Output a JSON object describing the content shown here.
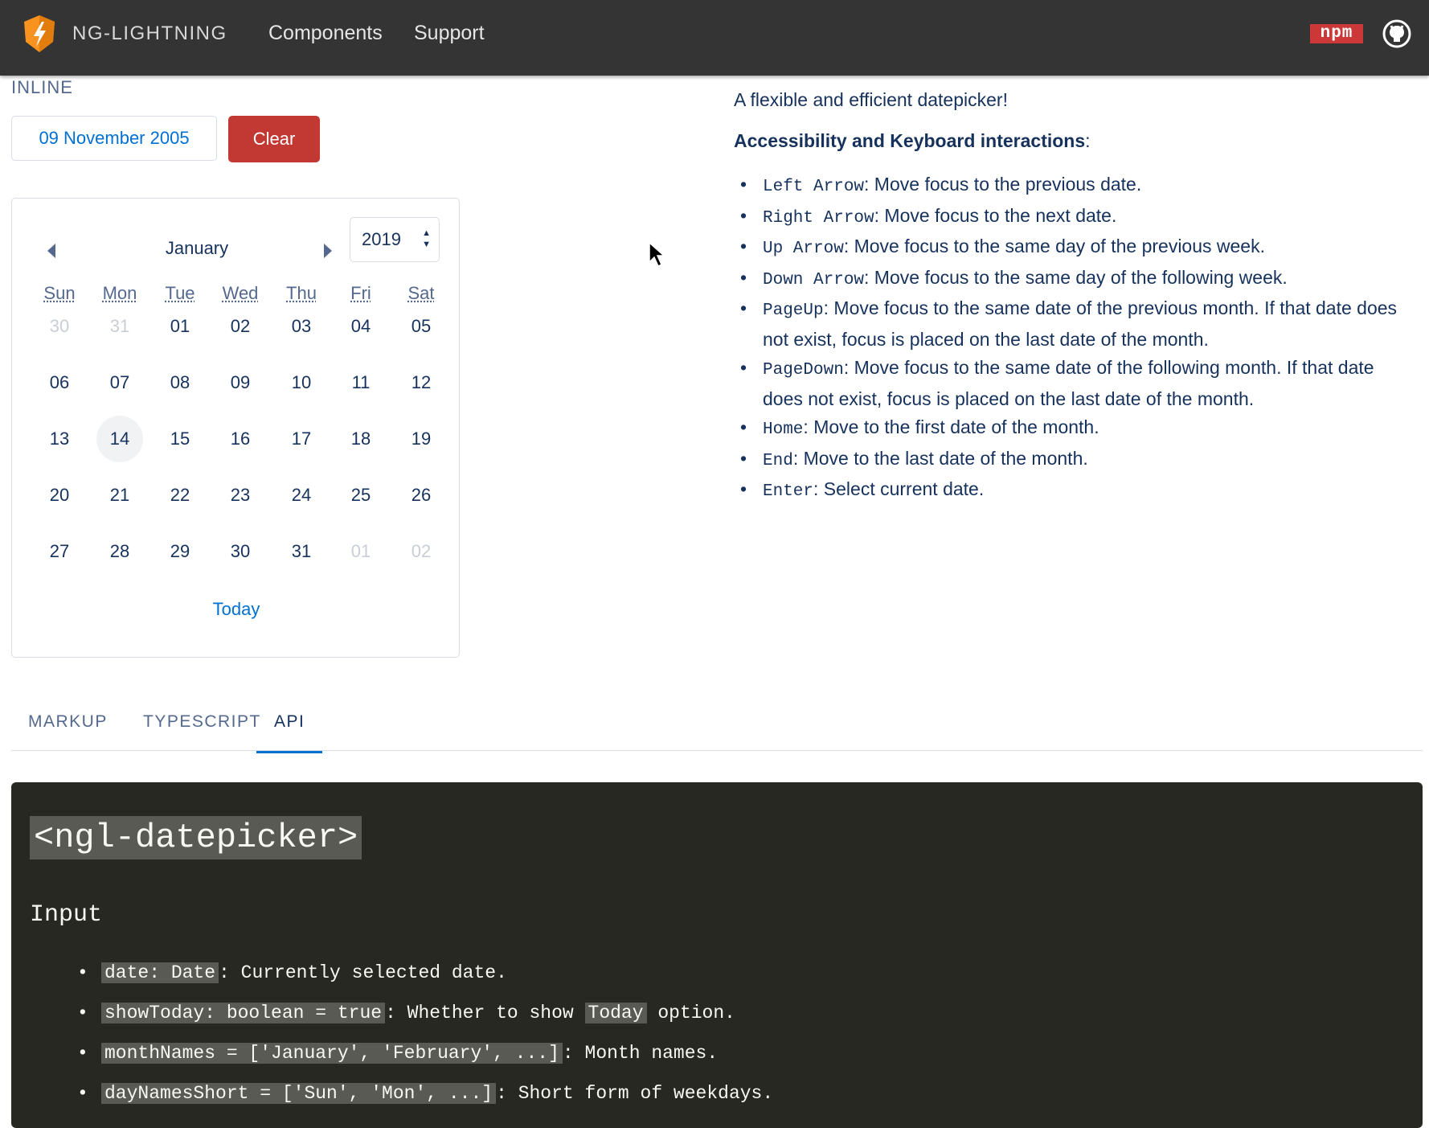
{
  "colors": {
    "topbar": "#343434",
    "accent": "#0070d2",
    "danger": "#c23934",
    "text": "#16325c",
    "code_bg": "#272822"
  },
  "header": {
    "brand": "NG-LIGHTNING",
    "nav": [
      "Components",
      "Support"
    ],
    "npm_label": "npm",
    "icons": [
      "lightning-logo-icon",
      "npm-icon",
      "github-icon"
    ]
  },
  "demo": {
    "section_label": "INLINE",
    "input_value": "09 November 2005",
    "clear_label": "Clear",
    "calendar": {
      "month": "January",
      "year": "2019",
      "day_headers": [
        "Sun",
        "Mon",
        "Tue",
        "Wed",
        "Thu",
        "Fri",
        "Sat"
      ],
      "weeks": [
        [
          "30",
          "31",
          "01",
          "02",
          "03",
          "04",
          "05"
        ],
        [
          "06",
          "07",
          "08",
          "09",
          "10",
          "11",
          "12"
        ],
        [
          "13",
          "14",
          "15",
          "16",
          "17",
          "18",
          "19"
        ],
        [
          "20",
          "21",
          "22",
          "23",
          "24",
          "25",
          "26"
        ],
        [
          "27",
          "28",
          "29",
          "30",
          "31",
          "01",
          "02"
        ]
      ],
      "today_label": "Today"
    }
  },
  "description": {
    "intro": "A flexible and efficient datepicker!",
    "kb_title": "Accessibility and Keyboard interactions",
    "kb_title_suffix": ":",
    "kb_items": [
      {
        "key": "Left Arrow",
        "text": ": Move focus to the previous date."
      },
      {
        "key": "Right Arrow",
        "text": ": Move focus to the next date."
      },
      {
        "key": "Up Arrow",
        "text": ": Move focus to the same day of the previous week."
      },
      {
        "key": "Down Arrow",
        "text": ": Move focus to the same day of the following week."
      },
      {
        "key": "PageUp",
        "text": ": Move focus to the same date of the previous month. If that date does not exist, focus is placed on the last date of the month."
      },
      {
        "key": "PageDown",
        "text": ": Move focus to the same date of the following month. If that date does not exist, focus is placed on the last date of the month."
      },
      {
        "key": "Home",
        "text": ": Move to the first date of the month."
      },
      {
        "key": "End",
        "text": ": Move to the last date of the month."
      },
      {
        "key": "Enter",
        "text": ": Select current date."
      }
    ]
  },
  "tabs": [
    "MARKUP",
    "TYPESCRIPT",
    "API"
  ],
  "api": {
    "component": "<ngl-datepicker>",
    "section": "Input",
    "items": [
      {
        "code": "date: Date",
        "text": ": Currently selected date."
      },
      {
        "code": "showToday: boolean = true",
        "text": ": Whether to show ",
        "code2": "Today",
        "text2": " option."
      },
      {
        "code": "monthNames = ['January', 'February', ...]",
        "text": ": Month names."
      },
      {
        "code": "dayNamesShort = ['Sun', 'Mon', ...]",
        "text": ": Short form of weekdays."
      }
    ]
  }
}
